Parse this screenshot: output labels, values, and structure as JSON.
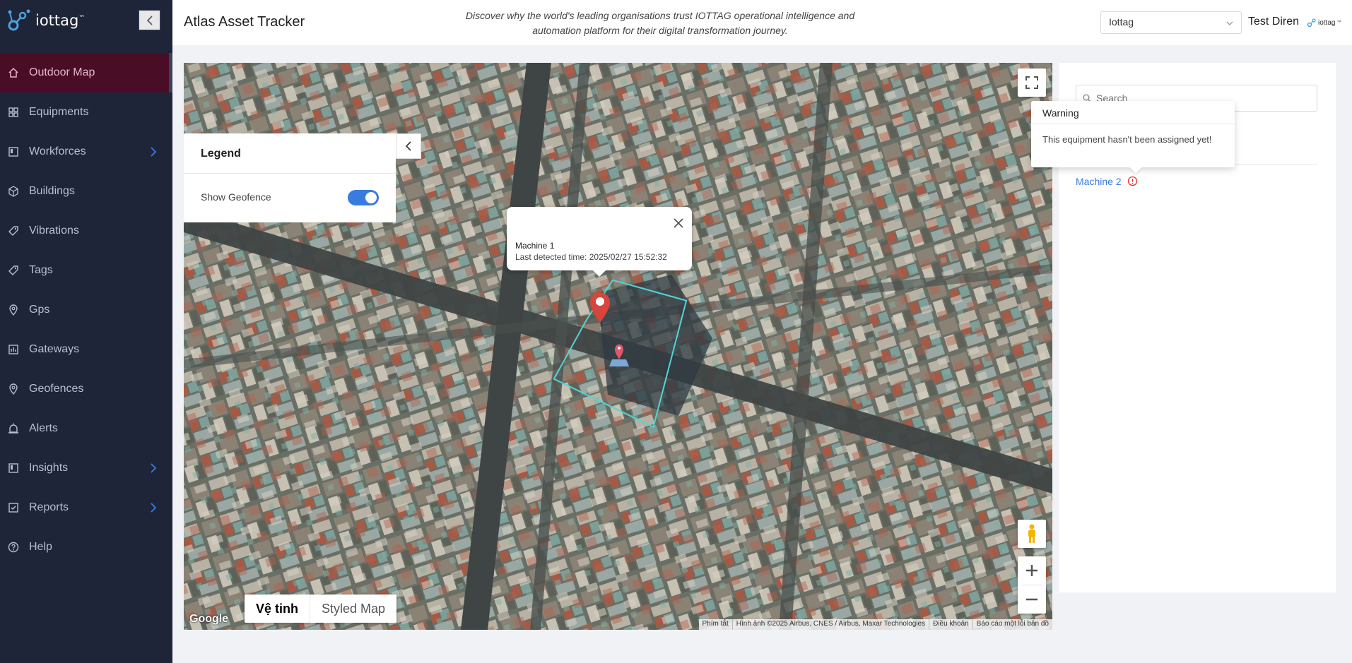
{
  "brand": {
    "name": "iottag",
    "tm": "™"
  },
  "header": {
    "title": "Atlas Asset Tracker",
    "tagline": "Discover why the world's leading organisations trust IOTTAG operational intelligence and automation platform for their digital transformation journey.",
    "org_select_value": "Iottag",
    "username": "Test Diren",
    "logo_text": "iottag",
    "logo_tm": "™"
  },
  "sidebar": {
    "items": [
      {
        "label": "Outdoor Map",
        "icon": "home-icon",
        "active": true
      },
      {
        "label": "Equipments",
        "icon": "grid-icon"
      },
      {
        "label": "Workforces",
        "icon": "board-icon",
        "submenu": true
      },
      {
        "label": "Buildings",
        "icon": "cube-icon"
      },
      {
        "label": "Vibrations",
        "icon": "tag-icon"
      },
      {
        "label": "Tags",
        "icon": "tag-icon"
      },
      {
        "label": "Gps",
        "icon": "pin-icon"
      },
      {
        "label": "Gateways",
        "icon": "chart-icon"
      },
      {
        "label": "Geofences",
        "icon": "pin-icon"
      },
      {
        "label": "Alerts",
        "icon": "alarm-icon"
      },
      {
        "label": "Insights",
        "icon": "board-icon",
        "submenu": true
      },
      {
        "label": "Reports",
        "icon": "check-icon",
        "submenu": true
      },
      {
        "label": "Help",
        "icon": "help-icon"
      }
    ]
  },
  "legend": {
    "title": "Legend",
    "geofence_label": "Show Geofence",
    "geofence_on": true
  },
  "popup": {
    "name": "Machine 1",
    "time": "Last detected time: 2025/02/27 15:52:32"
  },
  "map": {
    "types": [
      "Vệ tinh",
      "Styled Map"
    ],
    "selected_type": "Vệ tinh",
    "google_label": "Google",
    "attribution": [
      "Phím tắt",
      "Hình ảnh ©2025 Airbus, CNES / Airbus, Maxar Technologies",
      "Điều khoản",
      "Báo cáo một lỗi bản đồ"
    ]
  },
  "right_panel": {
    "search_placeholder": "Search",
    "items": [
      {
        "label": "Machine 2",
        "warning": true
      }
    ]
  },
  "tooltip": {
    "title": "Warning",
    "message": "This equipment hasn't been assigned yet!"
  },
  "colors": {
    "sidebar_bg": "#1f2538",
    "active_bg": "#4a0d26",
    "accent": "#3a7be0",
    "warning": "#e0312a",
    "geofence": "#4fd6d6"
  }
}
